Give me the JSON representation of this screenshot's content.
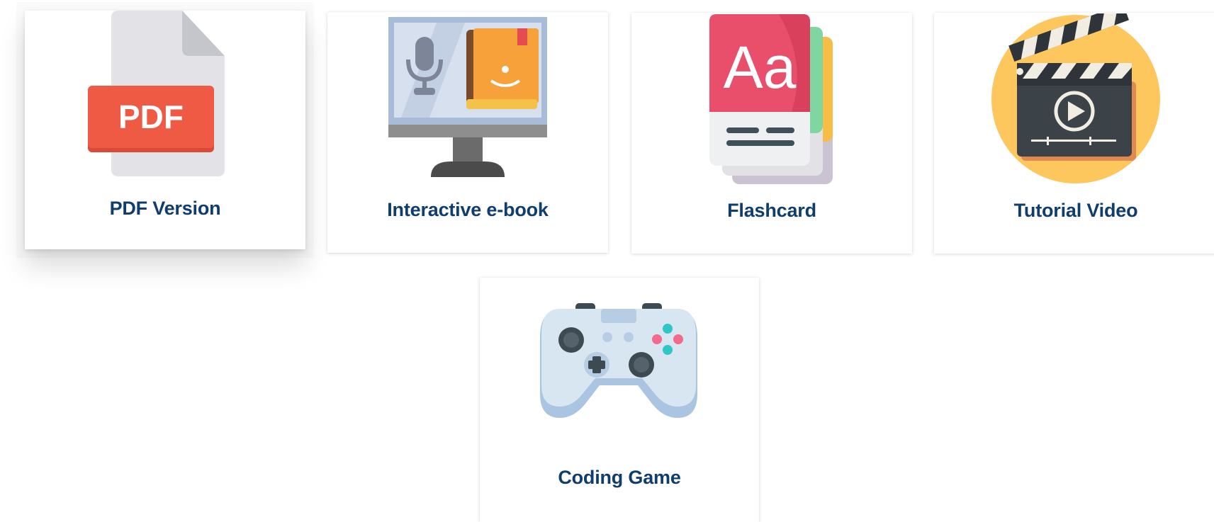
{
  "resources": [
    {
      "label": "PDF Version",
      "icon": "pdf-file-icon",
      "badge_text": "PDF"
    },
    {
      "label": "Interactive e-book",
      "icon": "monitor-ebook-icon"
    },
    {
      "label": "Flashcard",
      "icon": "flashcard-stack-icon",
      "card_text": "Aa"
    },
    {
      "label": "Tutorial Video",
      "icon": "clapperboard-icon"
    },
    {
      "label": "Coding Game",
      "icon": "game-controller-icon"
    }
  ],
  "colors": {
    "label_text": "#0f3d6e",
    "pdf_badge": "#ef5a44",
    "flashcard_front": "#e94e6a",
    "clapper_bg": "#fdc75e",
    "controller_body": "#d8e6f2"
  }
}
